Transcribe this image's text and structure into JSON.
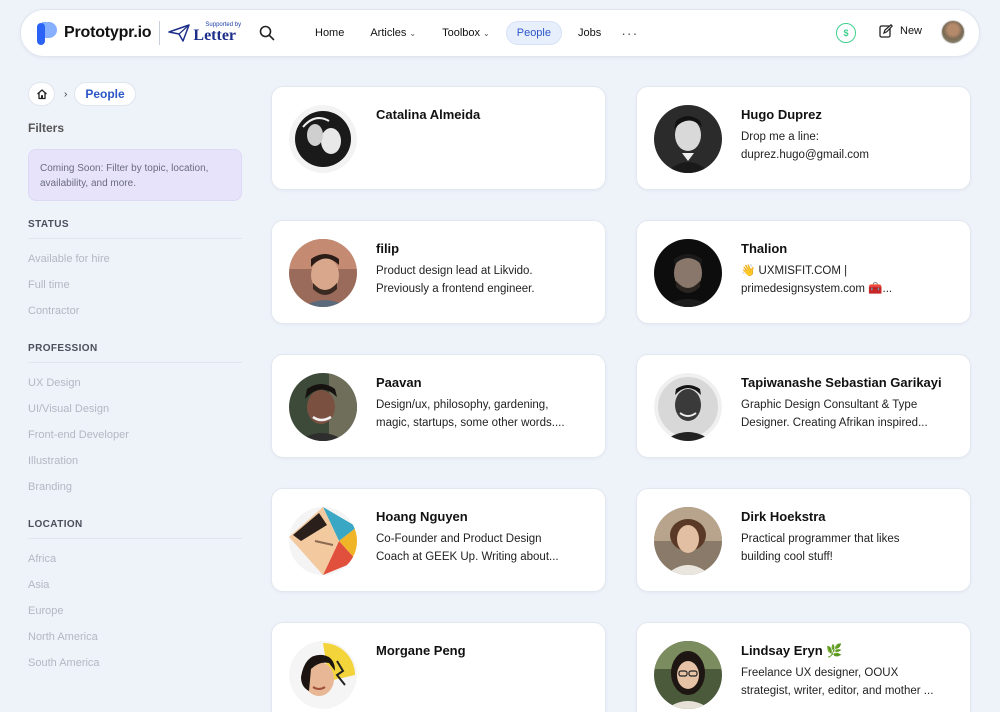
{
  "brand": {
    "name": "Prototypr.io",
    "supported_by": "Supported by",
    "partner": "Letter"
  },
  "nav": {
    "items": [
      {
        "label": "Home",
        "dropdown": false,
        "active": false
      },
      {
        "label": "Articles",
        "dropdown": true,
        "active": false
      },
      {
        "label": "Toolbox",
        "dropdown": true,
        "active": false
      },
      {
        "label": "People",
        "dropdown": false,
        "active": true
      },
      {
        "label": "Jobs",
        "dropdown": false,
        "active": false
      }
    ],
    "more": "···",
    "dollar_icon": "$",
    "new_label": "New"
  },
  "breadcrumb": {
    "current": "People"
  },
  "sidebar": {
    "filters_title": "Filters",
    "coming_soon": "Coming Soon: Filter by topic, location, availability, and more.",
    "sections": [
      {
        "title": "STATUS",
        "items": [
          "Available for hire",
          "Full time",
          "Contractor"
        ]
      },
      {
        "title": "PROFESSION",
        "items": [
          "UX Design",
          "UI/Visual Design",
          "Front-end Developer",
          "Illustration",
          "Branding"
        ]
      },
      {
        "title": "LOCATION",
        "items": [
          "Africa",
          "Asia",
          "Europe",
          "North America",
          "South America"
        ]
      }
    ]
  },
  "people": [
    {
      "name": "Catalina Almeida",
      "bio1": "",
      "bio2": ""
    },
    {
      "name": "Hugo Duprez",
      "bio1": "Drop me a line:",
      "bio2": "duprez.hugo@gmail.com"
    },
    {
      "name": "filip",
      "bio1": "Product design lead at Likvido.",
      "bio2": "Previously a frontend engineer."
    },
    {
      "name": "Thalion",
      "bio1": "👋 UXMISFIT.COM |",
      "bio2": "primedesignsystem.com 🧰..."
    },
    {
      "name": "Paavan",
      "bio1": "Design/ux, philosophy, gardening,",
      "bio2": "magic, startups, some other words...."
    },
    {
      "name": "Tapiwanashe Sebastian Garikayi",
      "bio1": "Graphic Design Consultant & Type",
      "bio2": "Designer. Creating Afrikan inspired..."
    },
    {
      "name": "Hoang Nguyen",
      "bio1": "Co-Founder and Product Design",
      "bio2": "Coach at GEEK Up. Writing about..."
    },
    {
      "name": "Dirk Hoekstra",
      "bio1": "Practical programmer that likes",
      "bio2": "building cool stuff!"
    },
    {
      "name": "Morgane Peng",
      "bio1": "",
      "bio2": ""
    },
    {
      "name": "Lindsay Eryn 🌿",
      "bio1": "Freelance UX designer, OOUX",
      "bio2": "strategist, writer, editor, and mother ..."
    }
  ],
  "colors": {
    "accent": "#2b56c6",
    "background": "#eef2f9",
    "coming_soon_bg": "#e6e3fb",
    "dollar_green": "#3fcf8e"
  }
}
